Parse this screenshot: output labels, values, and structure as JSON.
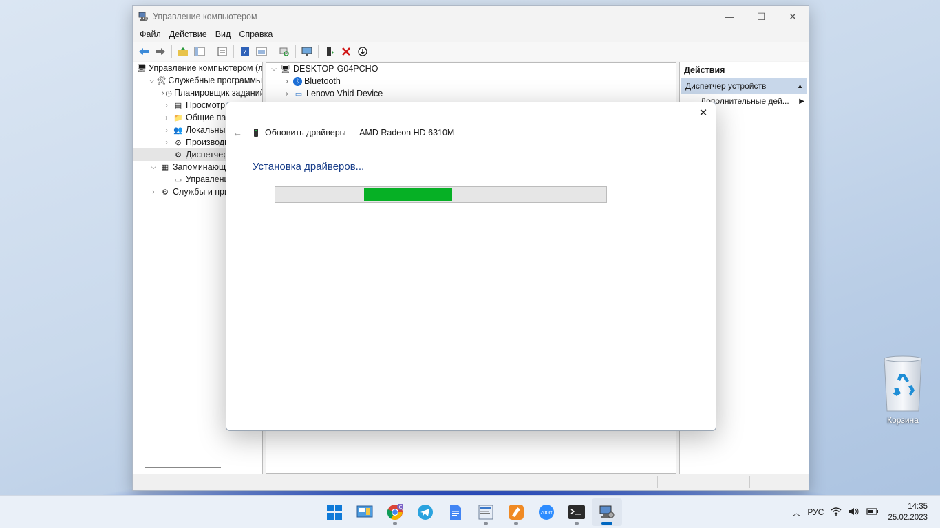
{
  "window": {
    "title": "Управление компьютером",
    "menu": [
      "Файл",
      "Действие",
      "Вид",
      "Справка"
    ]
  },
  "left_tree": [
    {
      "label": "Управление компьютером (л",
      "indent": 0,
      "arrow": "",
      "icon": "computer-management-icon"
    },
    {
      "label": "Служебные программы",
      "indent": 1,
      "arrow": "⌄",
      "icon": "tools-icon"
    },
    {
      "label": "Планировщик заданий",
      "indent": 2,
      "arrow": "›",
      "icon": "clock-icon"
    },
    {
      "label": "Просмотр со",
      "indent": 2,
      "arrow": "›",
      "icon": "event-viewer-icon"
    },
    {
      "label": "Общие папки",
      "indent": 2,
      "arrow": "›",
      "icon": "shared-folder-icon"
    },
    {
      "label": "Локальные п",
      "indent": 2,
      "arrow": "›",
      "icon": "users-icon"
    },
    {
      "label": "Производите",
      "indent": 2,
      "arrow": "›",
      "icon": "performance-icon"
    },
    {
      "label": "Диспетчер ус",
      "indent": 2,
      "arrow": "",
      "icon": "device-manager-icon",
      "selected": true
    },
    {
      "label": "Запоминающие",
      "indent": 1,
      "arrow": "⌄",
      "icon": "storage-icon"
    },
    {
      "label": "Управление д",
      "indent": 2,
      "arrow": "",
      "icon": "disk-management-icon"
    },
    {
      "label": "Службы и прило",
      "indent": 1,
      "arrow": "›",
      "icon": "services-icon"
    }
  ],
  "center_tree": [
    {
      "label": "DESKTOP-G04PCHO",
      "indent": 0,
      "arrow": "⌄",
      "icon": "computer-icon"
    },
    {
      "label": "Bluetooth",
      "indent": 1,
      "arrow": "›",
      "icon": "bluetooth-icon"
    },
    {
      "label": "Lenovo Vhid Device",
      "indent": 1,
      "arrow": "›",
      "icon": "monitor-icon"
    }
  ],
  "actions": {
    "header": "Действия",
    "item": "Диспетчер устройств",
    "sub": "Дополнительные дей..."
  },
  "dialog": {
    "header": "Обновить драйверы — AMD Radeon HD 6310M",
    "status": "Установка драйверов...",
    "progress_start": 0.269,
    "progress_length": 0.265
  },
  "desktop": {
    "recycle_bin": "Корзина"
  },
  "taskbar": {
    "apps": [
      "start-icon",
      "control-panel-icon",
      "chrome-icon",
      "telegram-icon",
      "docs-icon",
      "editor-icon",
      "notes-icon",
      "zoom-icon",
      "terminal-icon",
      "computer-management-icon"
    ],
    "language": "РУС",
    "time": "14:35",
    "date": "25.02.2023"
  },
  "colors": {
    "accent": "#0067c0",
    "progress": "#06b025",
    "status_text": "#1a3f8a"
  }
}
